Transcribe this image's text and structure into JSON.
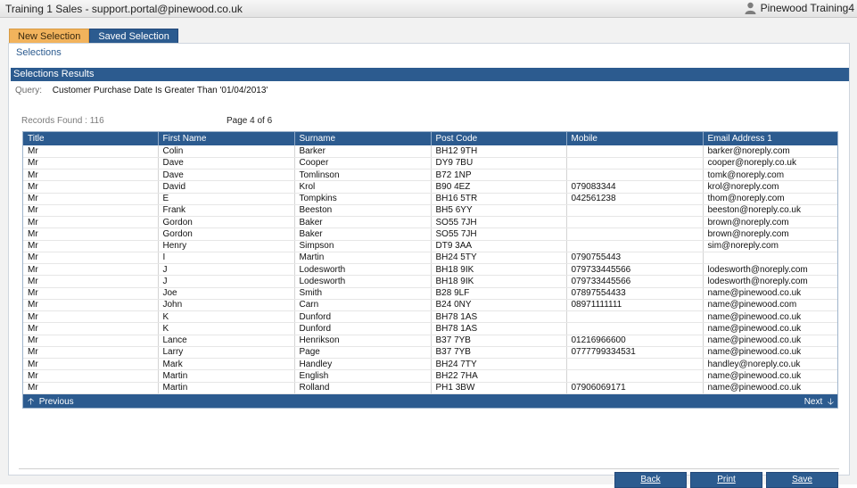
{
  "window": {
    "title": "Training 1 Sales - support.portal@pinewood.co.uk",
    "user": "Pinewood Training4",
    "user_icon": "user-icon"
  },
  "tabs": [
    {
      "label": "New Selection",
      "active": true
    },
    {
      "label": "Saved Selection",
      "active": false
    }
  ],
  "panel": {
    "heading": "Selections",
    "section_title": "Selections Results",
    "query_label": "Query:",
    "query_value": "Customer Purchase Date Is Greater Than '01/04/2013'",
    "records_found": "Records Found : 116",
    "page_info": "Page 4 of 6"
  },
  "table": {
    "columns": [
      "Title",
      "First Name",
      "Surname",
      "Post Code",
      "Mobile",
      "Email Address 1"
    ],
    "rows": [
      [
        "Mr",
        "Colin",
        "Barker",
        "BH12 9TH",
        "",
        "barker@noreply.com"
      ],
      [
        "Mr",
        "Dave",
        "Cooper",
        "DY9 7BU",
        "",
        "cooper@noreply.co.uk"
      ],
      [
        "Mr",
        "Dave",
        "Tomlinson",
        "B72 1NP",
        "",
        "tomk@noreply.com"
      ],
      [
        "Mr",
        "David",
        "Krol",
        "B90 4EZ",
        "079083344",
        "krol@noreply.com"
      ],
      [
        "Mr",
        "E",
        "Tompkins",
        "BH16 5TR",
        "042561238",
        "thom@noreply.com"
      ],
      [
        "Mr",
        "Frank",
        "Beeston",
        "BH5 6YY",
        "",
        "beeston@noreply.co.uk"
      ],
      [
        "Mr",
        "Gordon",
        "Baker",
        "SO55 7JH",
        "",
        "brown@noreply.com"
      ],
      [
        "Mr",
        "Gordon",
        "Baker",
        "SO55 7JH",
        "",
        "brown@noreply.com"
      ],
      [
        "Mr",
        "Henry",
        "Simpson",
        "DT9 3AA",
        "",
        "sim@noreply.com"
      ],
      [
        "Mr",
        "I",
        "Martin",
        "BH24 5TY",
        "0790755443",
        ""
      ],
      [
        "Mr",
        "J",
        "Lodesworth",
        "BH18 9IK",
        "079733445566",
        "lodesworth@noreply.com"
      ],
      [
        "Mr",
        "J",
        "Lodesworth",
        "BH18 9IK",
        "079733445566",
        "lodesworth@noreply.com"
      ],
      [
        "Mr",
        "Joe",
        "Smith",
        "B28 9LF",
        "07897554433",
        "name@pinewood.co.uk"
      ],
      [
        "Mr",
        "John",
        "Carn",
        "B24 0NY",
        "08971111111",
        "name@pinewood.com"
      ],
      [
        "Mr",
        "K",
        "Dunford",
        "BH78 1AS",
        "",
        "name@pinewood.co.uk"
      ],
      [
        "Mr",
        "K",
        "Dunford",
        "BH78 1AS",
        "",
        "name@pinewood.co.uk"
      ],
      [
        "Mr",
        "Lance",
        "Henrikson",
        "B37 7YB",
        "01216966600",
        "name@pinewood.co.uk"
      ],
      [
        "Mr",
        "Larry",
        "Page",
        "B37 7YB",
        "0777799334531",
        "name@pinewood.co.uk"
      ],
      [
        "Mr",
        "Mark",
        "Handley",
        "BH24 7TY",
        "",
        "handley@noreply.co.uk"
      ],
      [
        "Mr",
        "Martin",
        "English",
        "BH22 7HA",
        "",
        "name@pinewood.co.uk"
      ],
      [
        "Mr",
        "Martin",
        "Rolland",
        "PH1 3BW",
        "07906069171",
        "name@pinewood.co.uk"
      ]
    ],
    "prev_label": "Previous",
    "next_label": "Next"
  },
  "buttons": {
    "back": "Back",
    "print": "Print",
    "save": "Save"
  }
}
